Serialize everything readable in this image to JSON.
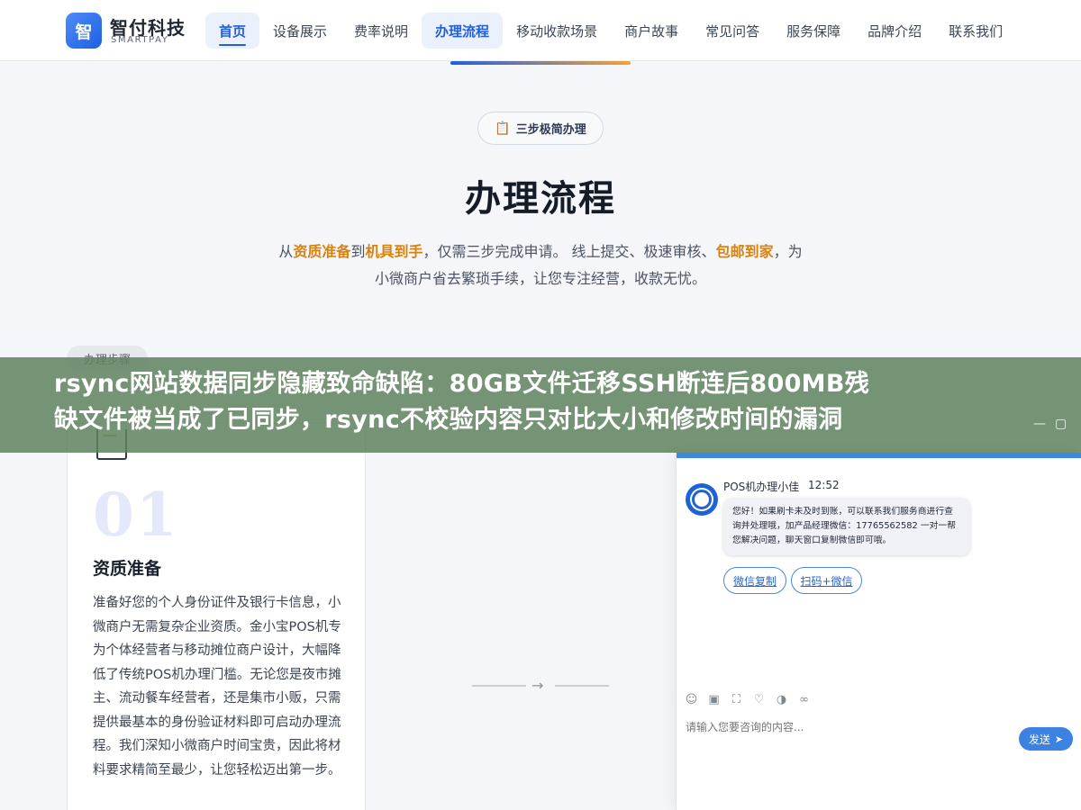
{
  "header": {
    "logo_mark": "智",
    "brand_name": "智付科技",
    "brand_sub": "SMARTPAY",
    "nav": [
      {
        "label": "首页",
        "state": "active"
      },
      {
        "label": "设备展示",
        "state": ""
      },
      {
        "label": "费率说明",
        "state": ""
      },
      {
        "label": "办理流程",
        "state": "current"
      },
      {
        "label": "移动收款场景",
        "state": ""
      },
      {
        "label": "商户故事",
        "state": ""
      },
      {
        "label": "常见问答",
        "state": ""
      },
      {
        "label": "服务保障",
        "state": ""
      },
      {
        "label": "品牌介绍",
        "state": ""
      },
      {
        "label": "联系我们",
        "state": ""
      }
    ]
  },
  "section": {
    "badge_icon": "clipboard-icon",
    "badge_label": "三步极简办理",
    "title": "办理流程",
    "desc_line1_a": "从",
    "desc_line1_b": "资质准备",
    "desc_line1_c": "到",
    "desc_line1_d": "机具到手",
    "desc_line1_e": "，仅需三步完成申请。 线上提交、极速审核、",
    "desc_line1_f": "包邮到家",
    "desc_line1_g": "，为",
    "desc_line2": "小微商户省去繁琐手续，让您专注经营，收款无忧。",
    "steps_tag": "办理步骤"
  },
  "step_card": {
    "number": "01",
    "title": "资质准备",
    "body": "准备好您的个人身份证件及银行卡信息，小微商户无需复杂企业资质。金小宝POS机专为个体经营者与移动摊位商户设计，大幅降低了传统POS机办理门槛。无论您是夜市摊主、流动餐车经营者，还是集市小贩，只需提供最基本的身份验证材料即可启动办理流程。我们深知小微商户时间宝贵，因此将材料要求精简至最少，让您轻松迈出第一步。"
  },
  "arrow": "→",
  "banner": {
    "line1": "rsync网站数据同步隐藏致命缺陷：80GB文件迁移SSH断连后800MB残",
    "line2": "缺文件被当成了已同步，rsync不校验内容只对比大小和修改时间的漏洞",
    "minimize": "—",
    "maximize": "▢"
  },
  "chat": {
    "agent_name": "POS机办理小佳",
    "time": "12:52",
    "message": "您好！如果刷卡未及时到账，可以联系我们服务商进行查询并处理哦，加产品经理微信：17765562582 一对一帮您解决问题，聊天窗口复制微信即可哦。",
    "chips": [
      "微信复制",
      "扫码+微信"
    ],
    "tools": [
      "smile-icon",
      "image-icon",
      "crop-icon",
      "heart-icon",
      "audio-icon",
      "link-icon"
    ],
    "input_placeholder": "请输入您要咨询的内容...",
    "send_label": "发送",
    "accent": "#3c82e0"
  }
}
